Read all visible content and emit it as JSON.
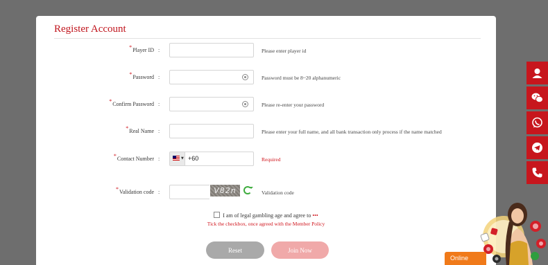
{
  "form": {
    "title": "Register Account",
    "colon": ":",
    "required_mark": "*",
    "fields": {
      "player_id": {
        "label": "Player ID",
        "hint": "Please enter player id",
        "value": ""
      },
      "password": {
        "label": "Password",
        "hint": "Password must be 8~20 alphanumeric",
        "value": ""
      },
      "confirm_password": {
        "label": "Confirm Password",
        "hint": "Please re-enter your password",
        "value": ""
      },
      "real_name": {
        "label": "Real Name",
        "hint": "Please enter your full name, and all bank transaction only process if the name matched",
        "value": ""
      },
      "contact_number": {
        "label": "Contact Number",
        "country_code": "+60",
        "hint": "Required",
        "flag": "malaysia-flag-icon"
      },
      "validation_code": {
        "label": "Validation code",
        "captcha_text": "V82n",
        "hint": "Validation code",
        "value": ""
      }
    },
    "agreement": {
      "text": "I am of legal gambling age and agree to",
      "link_dots": "•••",
      "warning": "Tick the checkbox, once agreed with the Member Policy",
      "checked": false
    },
    "buttons": {
      "reset": "Reset",
      "join": "Join Now"
    }
  },
  "side_bar": {
    "items": [
      "customer-service-icon",
      "wechat-icon",
      "whatsapp-icon",
      "telegram-icon",
      "phone-icon"
    ],
    "color": "#c7161d"
  },
  "online_widget": {
    "label": "Online",
    "color": "#f07a1a"
  },
  "colors": {
    "accent": "#c0141c",
    "reset_button": "#a9a9a9",
    "join_button": "#f0a9a9"
  }
}
